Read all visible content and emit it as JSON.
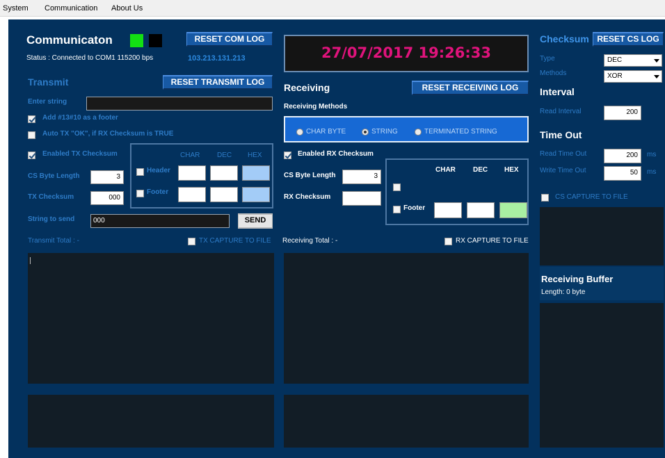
{
  "menu": {
    "system": "System",
    "communication": "Communication",
    "about": "About Us"
  },
  "com": {
    "title": "Communicaton",
    "status": "Status : Connected to COM1 115200 bps",
    "reset_label": "RESET COM LOG",
    "ip": "103.213.131.213",
    "led_on_color": "#13e013",
    "led_off_color": "#000000"
  },
  "clock": {
    "datetime": "27/07/2017 19:26:33"
  },
  "transmit": {
    "title": "Transmit",
    "reset_label": "RESET TRANSMIT LOG",
    "enter_string_label": "Enter string",
    "enter_string_value": "",
    "opt_footer_label": "Add #13#10 as a footer",
    "opt_auto_ok_label": "Auto TX \"OK\", if RX Checksum is TRUE",
    "opt_enable_cs_label": "Enabled TX Checksum",
    "cs_byte_length_label": "CS Byte Length",
    "cs_byte_length_value": "3",
    "tx_checksum_label": "TX Checksum",
    "tx_checksum_value": "000",
    "string_to_send_label": "String to send",
    "string_to_send_value": "000",
    "send_label": "SEND",
    "total_label": "Transmit Total : -",
    "capture_label": "TX CAPTURE TO FILE",
    "cols": {
      "char": "CHAR",
      "dec": "DEC",
      "hex": "HEX"
    },
    "header_label": "Header",
    "footer_label": "Footer"
  },
  "receiving": {
    "title": "Receiving",
    "reset_label": "RESET RECEIVING LOG",
    "methods_label": "Receiving Methods",
    "method_char": "CHAR BYTE",
    "method_string": "STRING",
    "method_terminated": "TERMINATED STRING",
    "enable_cs_label": "Enabled RX Checksum",
    "cs_byte_length_label": "CS Byte Length",
    "cs_byte_length_value": "3",
    "rx_checksum_label": "RX Checksum",
    "rx_checksum_value": "",
    "cols": {
      "char": "CHAR",
      "dec": "DEC",
      "hex": "HEX"
    },
    "footer_label": "Footer",
    "total_label": "Receiving Total : -",
    "capture_label": "RX CAPTURE TO FILE"
  },
  "checksum": {
    "title": "Checksum",
    "reset_label": "RESET CS LOG",
    "type_label": "Type",
    "type_value": "DEC",
    "methods_label": "Methods",
    "methods_value": "XOR",
    "interval_title": "Interval",
    "read_interval_label": "Read Interval",
    "read_interval_value": "200",
    "timeout_title": "Time Out",
    "read_timeout_label": "Read Time Out",
    "read_timeout_value": "200",
    "write_timeout_label": "Write Time Out",
    "write_timeout_value": "50",
    "ms": "ms",
    "capture_label": "CS CAPTURE TO FILE"
  },
  "buffer": {
    "title": "Receiving Buffer",
    "length": "Length: 0 byte"
  }
}
